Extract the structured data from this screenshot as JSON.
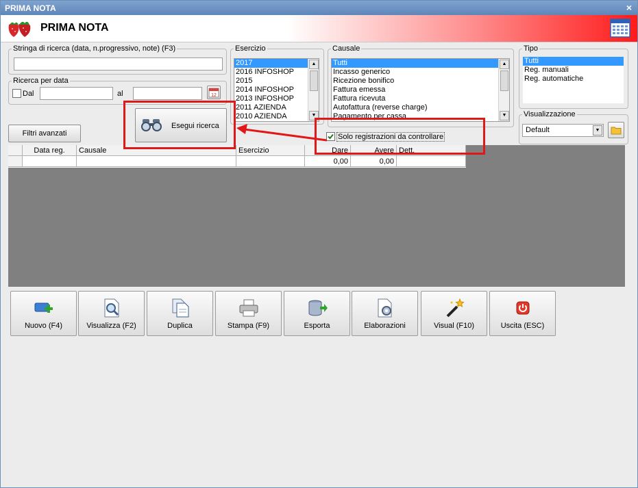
{
  "window": {
    "title": "PRIMA NOTA",
    "close": "×"
  },
  "header": {
    "title": "PRIMA NOTA",
    "logo_icon": "strawberries-icon",
    "calendar_icon": "calendar-icon",
    "accent": "#ff1a1a"
  },
  "search": {
    "label": "Stringa di ricerca (data, n.progressivo, note) (F3)",
    "value": ""
  },
  "date_search": {
    "label": "Ricerca per data",
    "dal_label": "Dal",
    "al_label": "al",
    "dal_value": "",
    "al_value": "",
    "calendar_icon": "calendar-icon"
  },
  "filters_button": "Filtri avanzati",
  "search_button": {
    "label": "Esegui ricerca",
    "icon": "binoculars-icon"
  },
  "esercizio": {
    "label": "Esercizio",
    "items": [
      "2017",
      "2016 INFOSHOP",
      "2015",
      "2014 INFOSHOP",
      "2013 INFOSHOP",
      "2011 AZIENDA",
      "2010 AZIENDA"
    ],
    "selected": "2017"
  },
  "causale": {
    "label": "Causale",
    "items": [
      "Tutti",
      "Incasso generico",
      "Ricezione bonifico",
      "Fattura emessa",
      "Fattura ricevuta",
      "Autofattura (reverse charge)",
      "Pagamento per cassa"
    ],
    "selected": "Tutti"
  },
  "controllare": {
    "label": "Solo registrazioni da controllare",
    "checked": true
  },
  "tipo": {
    "label": "Tipo",
    "items": [
      "Tutti",
      "Reg. manuali",
      "Reg. automatiche"
    ],
    "selected": "Tutti"
  },
  "visualizzazione": {
    "label": "Visualizzazione",
    "value": "Default",
    "folder_icon": "folder-icon"
  },
  "grid": {
    "columns": [
      "Data reg.",
      "Causale",
      "Esercizio",
      "Dare",
      "Avere",
      "Dett."
    ],
    "rows": [
      {
        "data": "",
        "causale": "",
        "esercizio": "",
        "dare": "0,00",
        "avere": "0,00",
        "dett": ""
      }
    ]
  },
  "toolbar": [
    {
      "label": "Nuovo (F4)",
      "icon": "new-record-icon"
    },
    {
      "label": "Visualizza (F2)",
      "icon": "view-document-icon"
    },
    {
      "label": "Duplica",
      "icon": "duplicate-icon"
    },
    {
      "label": "Stampa (F9)",
      "icon": "printer-icon"
    },
    {
      "label": "Esporta",
      "icon": "export-database-icon"
    },
    {
      "label": "Elaborazioni",
      "icon": "processing-gear-icon"
    },
    {
      "label": "Visual (F10)",
      "icon": "magic-wand-icon"
    },
    {
      "label": "Uscita (ESC)",
      "icon": "exit-power-icon"
    }
  ]
}
